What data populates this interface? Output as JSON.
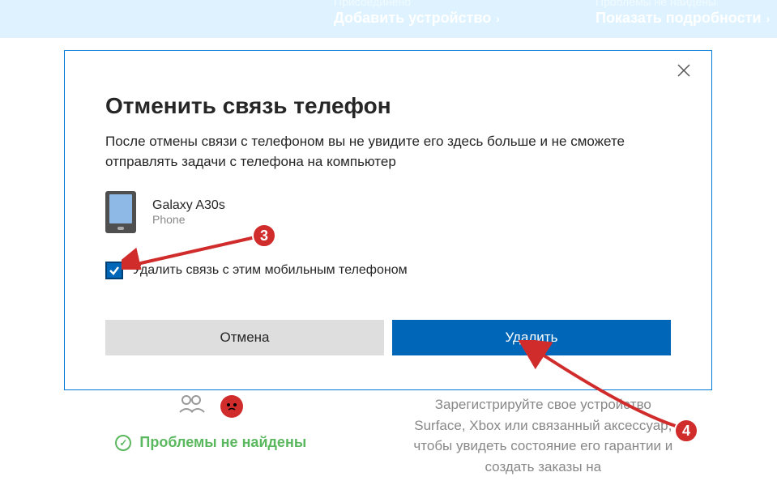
{
  "top": {
    "connected": "Присоединено",
    "add_device": "Добавить устройство",
    "no_problems": "Проблемы не найдены",
    "show_details": "Показать подробности"
  },
  "modal": {
    "title": "Отменить связь телефон",
    "description": "После отмены связи с телефоном вы не увидите его здесь больше и не сможете отправлять задачи с телефона на компьютер",
    "device_name": "Galaxy A30s",
    "device_type": "Phone",
    "checkbox_label": "Удалить связь с этим мобильным телефоном",
    "cancel_button": "Отмена",
    "delete_button": "Удалить"
  },
  "bg": {
    "no_problems": "Проблемы не найдены",
    "register_text": "Зарегистрируйте свое устройство Surface, Xbox или связанный аксессуар, чтобы увидеть состояние его гарантии и создать заказы на"
  },
  "annotations": {
    "badge3": "3",
    "badge4": "4"
  }
}
